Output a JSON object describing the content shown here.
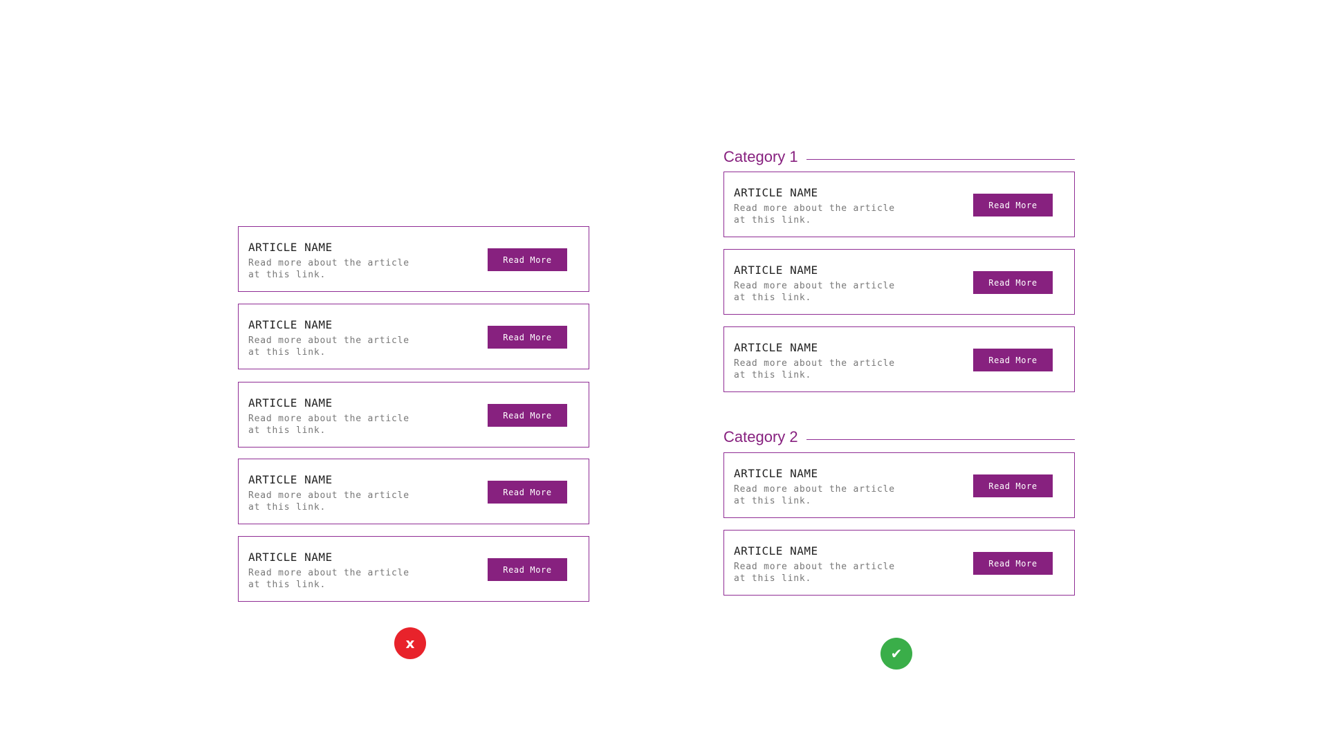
{
  "colors": {
    "accent": "#87217f",
    "card_border": "#8f2c94",
    "bad": "#e8232b",
    "good": "#3aae49"
  },
  "left_column": {
    "cards": [
      {
        "title": "ARTICLE NAME",
        "description": "Read more about the article at this link.",
        "button": "Read More"
      },
      {
        "title": "ARTICLE NAME",
        "description": "Read more about the article at this link.",
        "button": "Read More"
      },
      {
        "title": "ARTICLE NAME",
        "description": "Read more about the article at this link.",
        "button": "Read More"
      },
      {
        "title": "ARTICLE NAME",
        "description": "Read more about the article at this link.",
        "button": "Read More"
      },
      {
        "title": "ARTICLE NAME",
        "description": "Read more about the article at this link.",
        "button": "Read More"
      }
    ],
    "verdict_icon": "cross-icon",
    "verdict_glyph": "x"
  },
  "right_column": {
    "categories": [
      {
        "title": "Category 1",
        "cards": [
          {
            "title": "ARTICLE NAME",
            "description": "Read more about the article at this link.",
            "button": "Read More"
          },
          {
            "title": "ARTICLE NAME",
            "description": "Read more about the article at this link.",
            "button": "Read More"
          },
          {
            "title": "ARTICLE NAME",
            "description": "Read more about the article at this link.",
            "button": "Read More"
          }
        ]
      },
      {
        "title": "Category 2",
        "cards": [
          {
            "title": "ARTICLE NAME",
            "description": "Read more about the article at this link.",
            "button": "Read More"
          },
          {
            "title": "ARTICLE NAME",
            "description": "Read more about the article at this link.",
            "button": "Read More"
          }
        ]
      }
    ],
    "verdict_icon": "check-icon",
    "verdict_glyph": "✔"
  }
}
